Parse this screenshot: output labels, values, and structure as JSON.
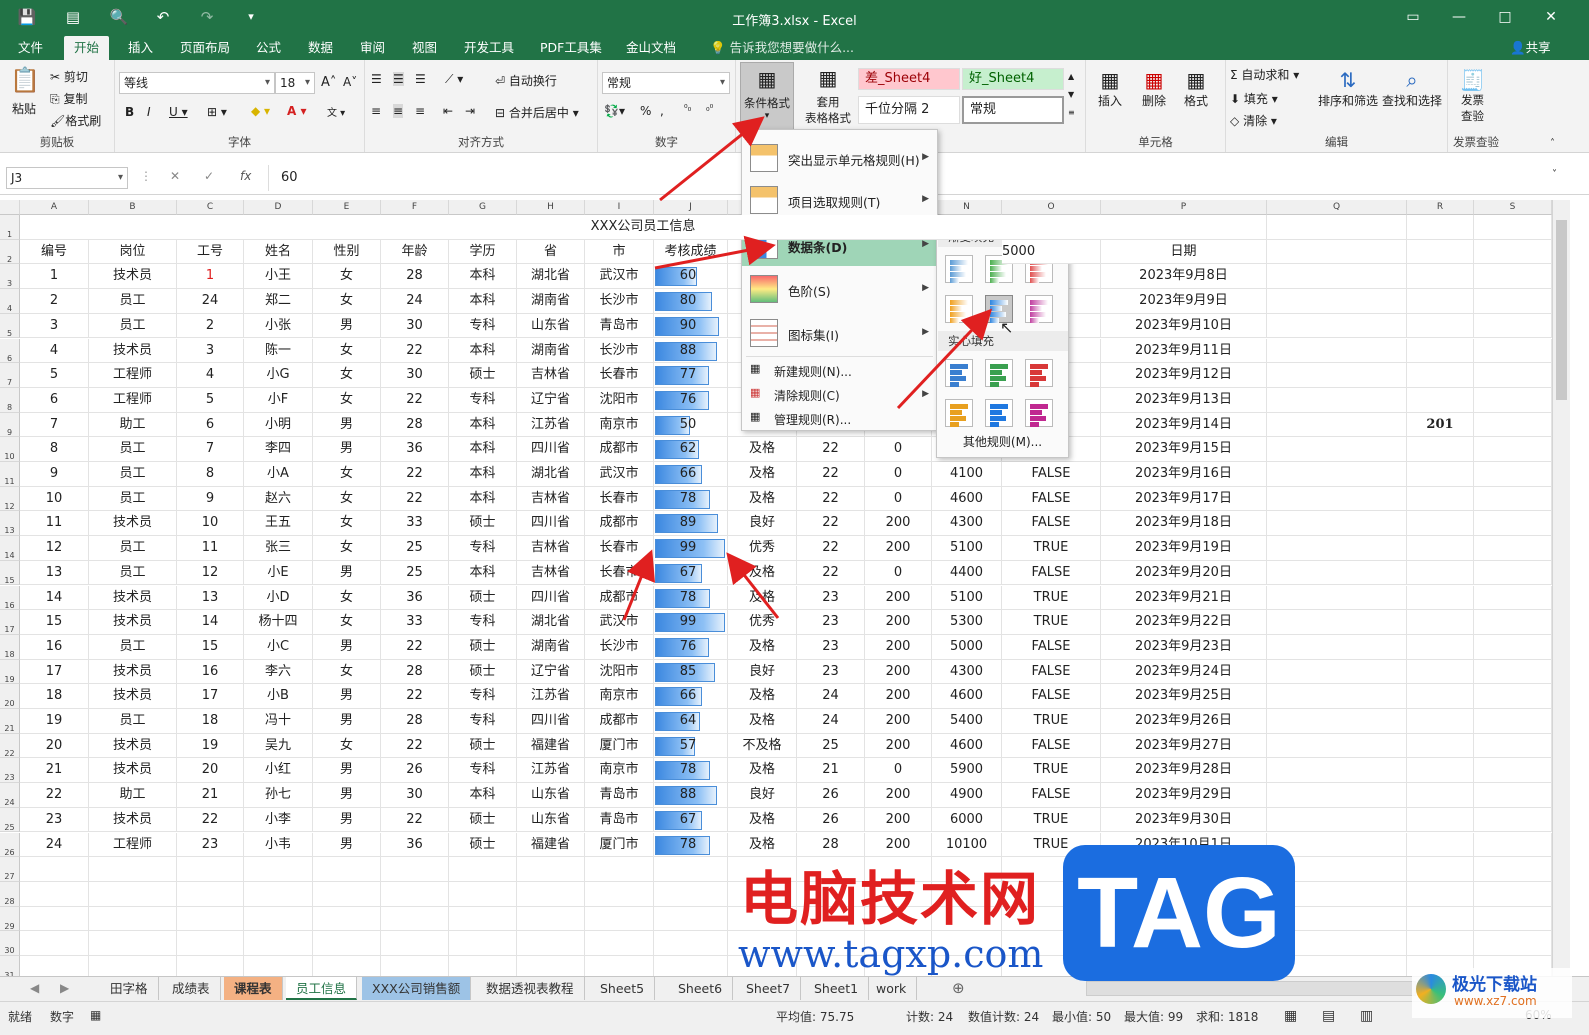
{
  "window": {
    "title": "工作簿3.xlsx - Excel"
  },
  "ribbon_tabs": [
    "文件",
    "开始",
    "插入",
    "页面布局",
    "公式",
    "数据",
    "审阅",
    "视图",
    "开发工具",
    "PDF工具集",
    "金山文档"
  ],
  "tell_me": "告诉我您想要做什么...",
  "share": "共享",
  "clipboard": {
    "paste": "粘贴",
    "cut": "剪切",
    "copy": "复制",
    "format_painter": "格式刷",
    "label": "剪贴板"
  },
  "font": {
    "name": "等线",
    "size": "18",
    "label": "字体"
  },
  "alignment": {
    "wrap": "自动换行",
    "merge": "合并后居中",
    "label": "对齐方式"
  },
  "number": {
    "format": "常规",
    "label": "数字"
  },
  "styles": {
    "cond_format": "条件格式",
    "table_format_1": "套用",
    "table_format_2": "表格格式",
    "gallery": [
      "差_Sheet4",
      "好_Sheet4",
      "千位分隔 2",
      "常规"
    ]
  },
  "cells": {
    "insert": "插入",
    "delete": "删除",
    "format": "格式",
    "label": "单元格"
  },
  "editing": {
    "autosum": "自动求和",
    "fill": "填充",
    "clear": "清除",
    "sort": "排序和筛选",
    "find": "查找和选择",
    "label": "编辑"
  },
  "invoice": {
    "l1": "发票",
    "l2": "查验",
    "label": "发票查验"
  },
  "formula_bar": {
    "name_box": "J3",
    "fx": "fx",
    "value": "60"
  },
  "columns": [
    "A",
    "B",
    "C",
    "D",
    "E",
    "F",
    "G",
    "H",
    "I",
    "J",
    "K",
    "L",
    "M",
    "N",
    "O",
    "P",
    "Q",
    "R",
    "S"
  ],
  "sheet_title": "XXX公司员工信息",
  "headers": [
    "编号",
    "岗位",
    "工号",
    "姓名",
    "性别",
    "年龄",
    "学历",
    "省",
    "市",
    "考核成绩"
  ],
  "header_partial_o": "5000",
  "header_date": "日期",
  "rows": [
    [
      "1",
      "技术员",
      "1",
      "小王",
      "女",
      "28",
      "本科",
      "湖北省",
      "武汉市",
      "60",
      "",
      "",
      "",
      "",
      "",
      "2023年9月8日"
    ],
    [
      "2",
      "员工",
      "24",
      "郑二",
      "女",
      "24",
      "本科",
      "湖南省",
      "长沙市",
      "80",
      "",
      "",
      "",
      "",
      "",
      "2023年9月9日"
    ],
    [
      "3",
      "员工",
      "2",
      "小张",
      "男",
      "30",
      "专科",
      "山东省",
      "青岛市",
      "90",
      "",
      "",
      "",
      "",
      "",
      "2023年9月10日"
    ],
    [
      "4",
      "技术员",
      "3",
      "陈一",
      "女",
      "22",
      "本科",
      "湖南省",
      "长沙市",
      "88",
      "",
      "",
      "",
      "",
      "",
      "2023年9月11日"
    ],
    [
      "5",
      "工程师",
      "4",
      "小G",
      "女",
      "30",
      "硕士",
      "吉林省",
      "长春市",
      "77",
      "",
      "",
      "",
      "",
      "",
      "2023年9月12日"
    ],
    [
      "6",
      "工程师",
      "5",
      "小F",
      "女",
      "22",
      "专科",
      "辽宁省",
      "沈阳市",
      "76",
      "",
      "",
      "",
      "",
      "",
      "2023年9月13日"
    ],
    [
      "7",
      "助工",
      "6",
      "小明",
      "男",
      "28",
      "本科",
      "江苏省",
      "南京市",
      "50",
      "",
      "",
      "",
      "",
      "",
      "2023年9月14日"
    ],
    [
      "8",
      "员工",
      "7",
      "李四",
      "男",
      "36",
      "本科",
      "四川省",
      "成都市",
      "62",
      "及格",
      "22",
      "0",
      "",
      "",
      "2023年9月15日"
    ],
    [
      "9",
      "员工",
      "8",
      "小A",
      "女",
      "22",
      "本科",
      "湖北省",
      "武汉市",
      "66",
      "及格",
      "22",
      "0",
      "4100",
      "FALSE",
      "2023年9月16日"
    ],
    [
      "10",
      "员工",
      "9",
      "赵六",
      "女",
      "22",
      "本科",
      "吉林省",
      "长春市",
      "78",
      "及格",
      "22",
      "0",
      "4600",
      "FALSE",
      "2023年9月17日"
    ],
    [
      "11",
      "技术员",
      "10",
      "王五",
      "女",
      "33",
      "硕士",
      "四川省",
      "成都市",
      "89",
      "良好",
      "22",
      "200",
      "4300",
      "FALSE",
      "2023年9月18日"
    ],
    [
      "12",
      "员工",
      "11",
      "张三",
      "女",
      "25",
      "专科",
      "吉林省",
      "长春市",
      "99",
      "优秀",
      "22",
      "200",
      "5100",
      "TRUE",
      "2023年9月19日"
    ],
    [
      "13",
      "员工",
      "12",
      "小E",
      "男",
      "25",
      "本科",
      "吉林省",
      "长春市",
      "67",
      "及格",
      "22",
      "0",
      "4400",
      "FALSE",
      "2023年9月20日"
    ],
    [
      "14",
      "技术员",
      "13",
      "小D",
      "女",
      "36",
      "硕士",
      "四川省",
      "成都市",
      "78",
      "及格",
      "23",
      "200",
      "5100",
      "TRUE",
      "2023年9月21日"
    ],
    [
      "15",
      "技术员",
      "14",
      "杨十四",
      "女",
      "33",
      "专科",
      "湖北省",
      "武汉市",
      "99",
      "优秀",
      "23",
      "200",
      "5300",
      "TRUE",
      "2023年9月22日"
    ],
    [
      "16",
      "员工",
      "15",
      "小C",
      "男",
      "22",
      "硕士",
      "湖南省",
      "长沙市",
      "76",
      "及格",
      "23",
      "200",
      "5000",
      "FALSE",
      "2023年9月23日"
    ],
    [
      "17",
      "技术员",
      "16",
      "李六",
      "女",
      "28",
      "硕士",
      "辽宁省",
      "沈阳市",
      "85",
      "良好",
      "23",
      "200",
      "4300",
      "FALSE",
      "2023年9月24日"
    ],
    [
      "18",
      "技术员",
      "17",
      "小B",
      "男",
      "22",
      "专科",
      "江苏省",
      "南京市",
      "66",
      "及格",
      "24",
      "200",
      "4600",
      "FALSE",
      "2023年9月25日"
    ],
    [
      "19",
      "员工",
      "18",
      "冯十",
      "男",
      "28",
      "专科",
      "四川省",
      "成都市",
      "64",
      "及格",
      "24",
      "200",
      "5400",
      "TRUE",
      "2023年9月26日"
    ],
    [
      "20",
      "技术员",
      "19",
      "吴九",
      "女",
      "22",
      "硕士",
      "福建省",
      "厦门市",
      "57",
      "不及格",
      "25",
      "200",
      "4600",
      "FALSE",
      "2023年9月27日"
    ],
    [
      "21",
      "技术员",
      "20",
      "小红",
      "男",
      "26",
      "专科",
      "江苏省",
      "南京市",
      "78",
      "及格",
      "21",
      "0",
      "5900",
      "TRUE",
      "2023年9月28日"
    ],
    [
      "22",
      "助工",
      "21",
      "孙七",
      "男",
      "30",
      "本科",
      "山东省",
      "青岛市",
      "88",
      "良好",
      "26",
      "200",
      "4900",
      "FALSE",
      "2023年9月29日"
    ],
    [
      "23",
      "技术员",
      "22",
      "小李",
      "男",
      "22",
      "硕士",
      "山东省",
      "青岛市",
      "67",
      "及格",
      "26",
      "200",
      "6000",
      "TRUE",
      "2023年9月30日"
    ],
    [
      "24",
      "工程师",
      "23",
      "小韦",
      "男",
      "36",
      "硕士",
      "福建省",
      "厦门市",
      "78",
      "及格",
      "28",
      "200",
      "10100",
      "TRUE",
      "2023年10月1日"
    ]
  ],
  "r9_value": "201",
  "cf_menu": [
    {
      "label": "突出显示单元格规则(H)",
      "sub": true
    },
    {
      "label": "项目选取规则(T)",
      "sub": true
    },
    {
      "label": "数据条(D)",
      "sub": true
    },
    {
      "label": "色阶(S)",
      "sub": true
    },
    {
      "label": "图标集(I)",
      "sub": true
    }
  ],
  "cf_menu_small": [
    "新建规则(N)...",
    "清除规则(C)",
    "管理规则(R)..."
  ],
  "databar_menu": {
    "gradient": "渐变填充",
    "solid": "实心填充",
    "more": "其他规则(M)..."
  },
  "sheet_tabs": [
    "田字格",
    "成绩表",
    "课程表",
    "员工信息",
    "XXX公司销售额",
    "数据透视表教程",
    "Sheet5",
    "Sheet6",
    "Sheet7",
    "Sheet1",
    "work"
  ],
  "status": {
    "ready": "就绪",
    "mode": "数字",
    "avg": "平均值: 75.75",
    "count": "计数: 24",
    "numcount": "数值计数: 24",
    "min": "最小值: 50",
    "max": "最大值: 99",
    "sum": "求和: 1818",
    "zoom": "60%"
  },
  "watermark": {
    "cn": "电脑技术网",
    "url": "www.tagxp.com",
    "tag": "TAG",
    "logo": "极光下载站",
    "logo_url": "www.xz7.com"
  },
  "colors": {
    "excel_green": "#217346",
    "databar": "#3c88e0",
    "arrow": "#e02020"
  }
}
